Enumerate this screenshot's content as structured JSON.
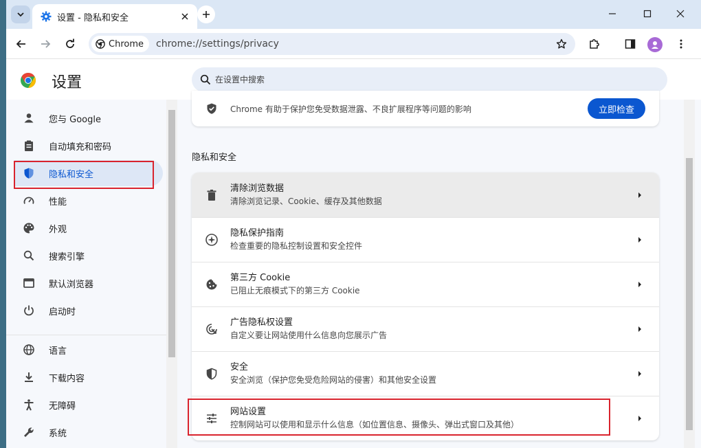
{
  "tab": {
    "title": "设置 - 隐私和安全"
  },
  "omnibox": {
    "chip_label": "Chrome",
    "url": "chrome://settings/privacy"
  },
  "settings": {
    "title": "设置",
    "search_placeholder": "在设置中搜索"
  },
  "sidebar": {
    "items": [
      {
        "label": "您与 Google",
        "icon": "person-icon"
      },
      {
        "label": "自动填充和密码",
        "icon": "clipboard-icon"
      },
      {
        "label": "隐私和安全",
        "icon": "shield-icon",
        "active": true
      },
      {
        "label": "性能",
        "icon": "speedometer-icon"
      },
      {
        "label": "外观",
        "icon": "palette-icon"
      },
      {
        "label": "搜索引擎",
        "icon": "search-icon"
      },
      {
        "label": "默认浏览器",
        "icon": "browser-window-icon"
      },
      {
        "label": "启动时",
        "icon": "power-icon"
      },
      {
        "label": "语言",
        "icon": "globe-icon"
      },
      {
        "label": "下载内容",
        "icon": "download-icon"
      },
      {
        "label": "无障碍",
        "icon": "accessibility-icon"
      },
      {
        "label": "系统",
        "icon": "wrench-icon"
      }
    ]
  },
  "safety_card": {
    "text": "Chrome 有助于保护您免受数据泄露、不良扩展程序等问题的影响",
    "button": "立即检查"
  },
  "privacy": {
    "section_title": "隐私和安全",
    "rows": [
      {
        "title": "清除浏览数据",
        "subtitle": "清除浏览记录、Cookie、缓存及其他数据",
        "icon": "trash-icon"
      },
      {
        "title": "隐私保护指南",
        "subtitle": "检查重要的隐私控制设置和安全控件",
        "icon": "compass-icon"
      },
      {
        "title": "第三方 Cookie",
        "subtitle": "已阻止无痕模式下的第三方 Cookie",
        "icon": "cookie-icon"
      },
      {
        "title": "广告隐私权设置",
        "subtitle": "自定义要让网站使用什么信息向您展示广告",
        "icon": "ad-privacy-icon"
      },
      {
        "title": "安全",
        "subtitle": "安全浏览（保护您免受危险网站的侵害）和其他安全设置",
        "icon": "shield-outline-icon"
      },
      {
        "title": "网站设置",
        "subtitle": "控制网站可以使用和显示什么信息（如位置信息、摄像头、弹出式窗口及其他）",
        "icon": "sliders-icon"
      }
    ]
  },
  "colors": {
    "accent": "#0b57d0",
    "highlight": "#d9232d",
    "active_nav_bg": "#dde7f6"
  }
}
